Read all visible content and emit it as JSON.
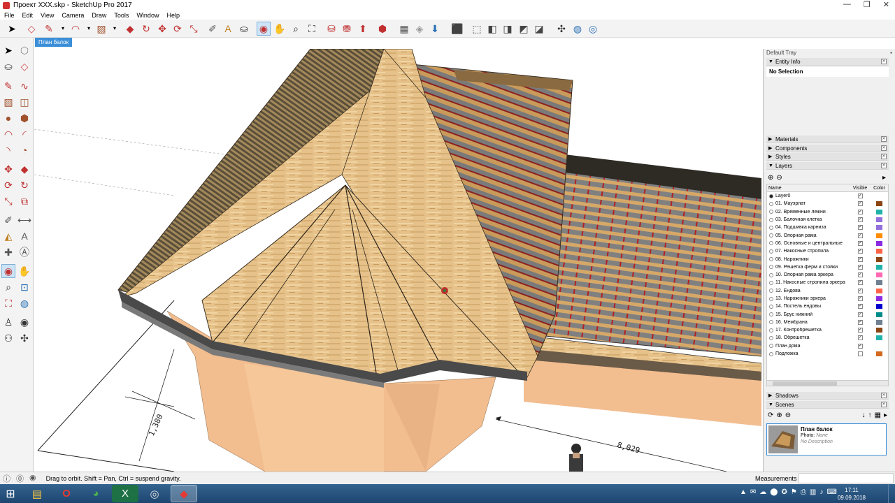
{
  "window": {
    "title": "Проект XXX.skp - SketchUp Pro 2017",
    "controls": [
      "—",
      "❐",
      "✕"
    ]
  },
  "menu": [
    "File",
    "Edit",
    "View",
    "Camera",
    "Draw",
    "Tools",
    "Window",
    "Help"
  ],
  "scene_tab": "План балок",
  "tray": {
    "title": "Default Tray",
    "entity_info": {
      "title": "Entity Info",
      "selection": "No Selection"
    },
    "panels": {
      "materials": "Materials",
      "components": "Components",
      "styles": "Styles",
      "layers": "Layers",
      "shadows": "Shadows",
      "scenes": "Scenes"
    },
    "layers_columns": {
      "name": "Name",
      "visible": "Visible",
      "color": "Color"
    },
    "layers": [
      {
        "name": "Layer0",
        "active": true,
        "visible": true,
        "color": ""
      },
      {
        "name": "01. Мауэрлат",
        "active": false,
        "visible": true,
        "color": "#8B4513"
      },
      {
        "name": "02. Временные лежни",
        "active": false,
        "visible": true,
        "color": "#20B2AA"
      },
      {
        "name": "03. Балочная клетка",
        "active": false,
        "visible": true,
        "color": "#9370DB"
      },
      {
        "name": "04. Подшивка карниза",
        "active": false,
        "visible": true,
        "color": "#9370DB"
      },
      {
        "name": "05. Опорная рама",
        "active": false,
        "visible": true,
        "color": "#FF8C00"
      },
      {
        "name": "06. Основные и центральные",
        "active": false,
        "visible": true,
        "color": "#8A2BE2"
      },
      {
        "name": "07. Накосные стропила",
        "active": false,
        "visible": true,
        "color": "#FF6347"
      },
      {
        "name": "08. Нарожники",
        "active": false,
        "visible": true,
        "color": "#8B4513"
      },
      {
        "name": "09. Решетка ферм и стойки",
        "active": false,
        "visible": true,
        "color": "#20B2AA"
      },
      {
        "name": "10. Опорная рама эркера",
        "active": false,
        "visible": true,
        "color": "#FF69B4"
      },
      {
        "name": "11. Накосные стропила эркера",
        "active": false,
        "visible": true,
        "color": "#708090"
      },
      {
        "name": "12. Ендова",
        "active": false,
        "visible": true,
        "color": "#FF6347"
      },
      {
        "name": "13. Нарожники эркера",
        "active": false,
        "visible": true,
        "color": "#8A2BE2"
      },
      {
        "name": "14. Постель ендовы",
        "active": false,
        "visible": true,
        "color": "#0000CD"
      },
      {
        "name": "15. Брус нижний",
        "active": false,
        "visible": true,
        "color": "#008B8B"
      },
      {
        "name": "16. Мембрана",
        "active": false,
        "visible": true,
        "color": "#708090"
      },
      {
        "name": "17. Контробрешетка",
        "active": false,
        "visible": true,
        "color": "#8B4513"
      },
      {
        "name": "18. Обрешетка",
        "active": false,
        "visible": true,
        "color": "#20B2AA"
      },
      {
        "name": "План дома",
        "active": false,
        "visible": true,
        "color": ""
      },
      {
        "name": "Подложка",
        "active": false,
        "visible": false,
        "color": "#D2691E"
      }
    ],
    "scene": {
      "name": "План балок",
      "photo_label": "Photo:",
      "photo_value": "None",
      "description": "No Description"
    }
  },
  "viewport": {
    "dimension_1": "1,380",
    "dimension_2": "8,029"
  },
  "status": {
    "hint": "Drag to orbit. Shift = Pan, Ctrl = suspend gravity.",
    "measurements_label": "Measurements"
  },
  "taskbar": {
    "time": "17:11",
    "date": "09.09.2018"
  }
}
